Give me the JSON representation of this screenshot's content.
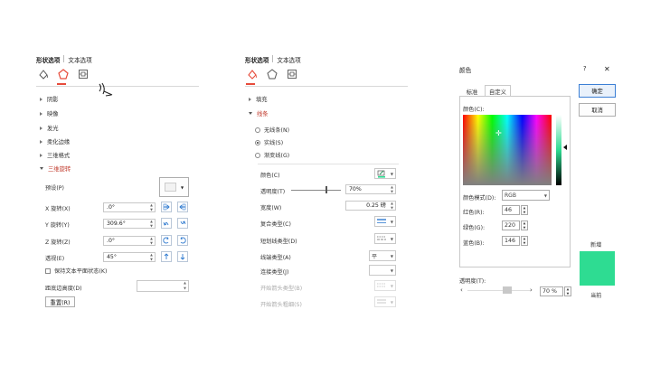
{
  "panel1": {
    "tabs": [
      "形状选项",
      "文本选项"
    ],
    "sections": [
      "阴影",
      "映像",
      "发光",
      "柔化边缘",
      "三维格式",
      "三维旋转"
    ],
    "preset_label": "预设(P)",
    "x_rot_label": "X 旋转(X)",
    "x_rot_value": ".0°",
    "y_rot_label": "Y 旋转(Y)",
    "y_rot_value": "309.6°",
    "z_rot_label": "Z 旋转(Z)",
    "z_rot_value": ".0°",
    "persp_label": "透视(E)",
    "persp_value": "45°",
    "keep_flat_label": "保持文本平面状态(K)",
    "ground_label": "距底边高度(D)",
    "ground_value": "",
    "reset_button": "重置(R)"
  },
  "panel2": {
    "tabs": [
      "形状选项",
      "文本选项"
    ],
    "fill_label": "填充",
    "line_label": "线条",
    "radios": [
      {
        "label": "无线条(N)",
        "on": false
      },
      {
        "label": "实线(S)",
        "on": true
      },
      {
        "label": "渐变线(G)",
        "on": false
      }
    ],
    "color_label": "颜色(C)",
    "trans_label": "透明度(T)",
    "trans_value": "70%",
    "width_label": "宽度(W)",
    "width_value": "0.25 磅",
    "compound_label": "复合类型(C)",
    "dash_label": "短划线类型(D)",
    "cap_label": "线端类型(A)",
    "cap_value": "平",
    "join_label": "连接类型(J)",
    "begin_arrow_type_label": "开始箭头类型(B)",
    "begin_arrow_size_label": "开始箭头粗细(S)"
  },
  "dialog": {
    "title": "颜色",
    "help": "?",
    "close": "✕",
    "tab_standard": "标准",
    "tab_custom": "自定义",
    "ok": "确定",
    "cancel": "取消",
    "colors_label": "颜色(C):",
    "model_label": "颜色模式(D):",
    "model_value": "RGB",
    "red_label": "红色(R):",
    "red_value": "46",
    "green_label": "绿色(G):",
    "green_value": "220",
    "blue_label": "蓝色(B):",
    "blue_value": "146",
    "trans_label": "透明度(T):",
    "trans_value": "70 %",
    "new_label": "新增",
    "current_label": "当前",
    "new_color": "#2edc92",
    "current_color": "#2edc92"
  }
}
